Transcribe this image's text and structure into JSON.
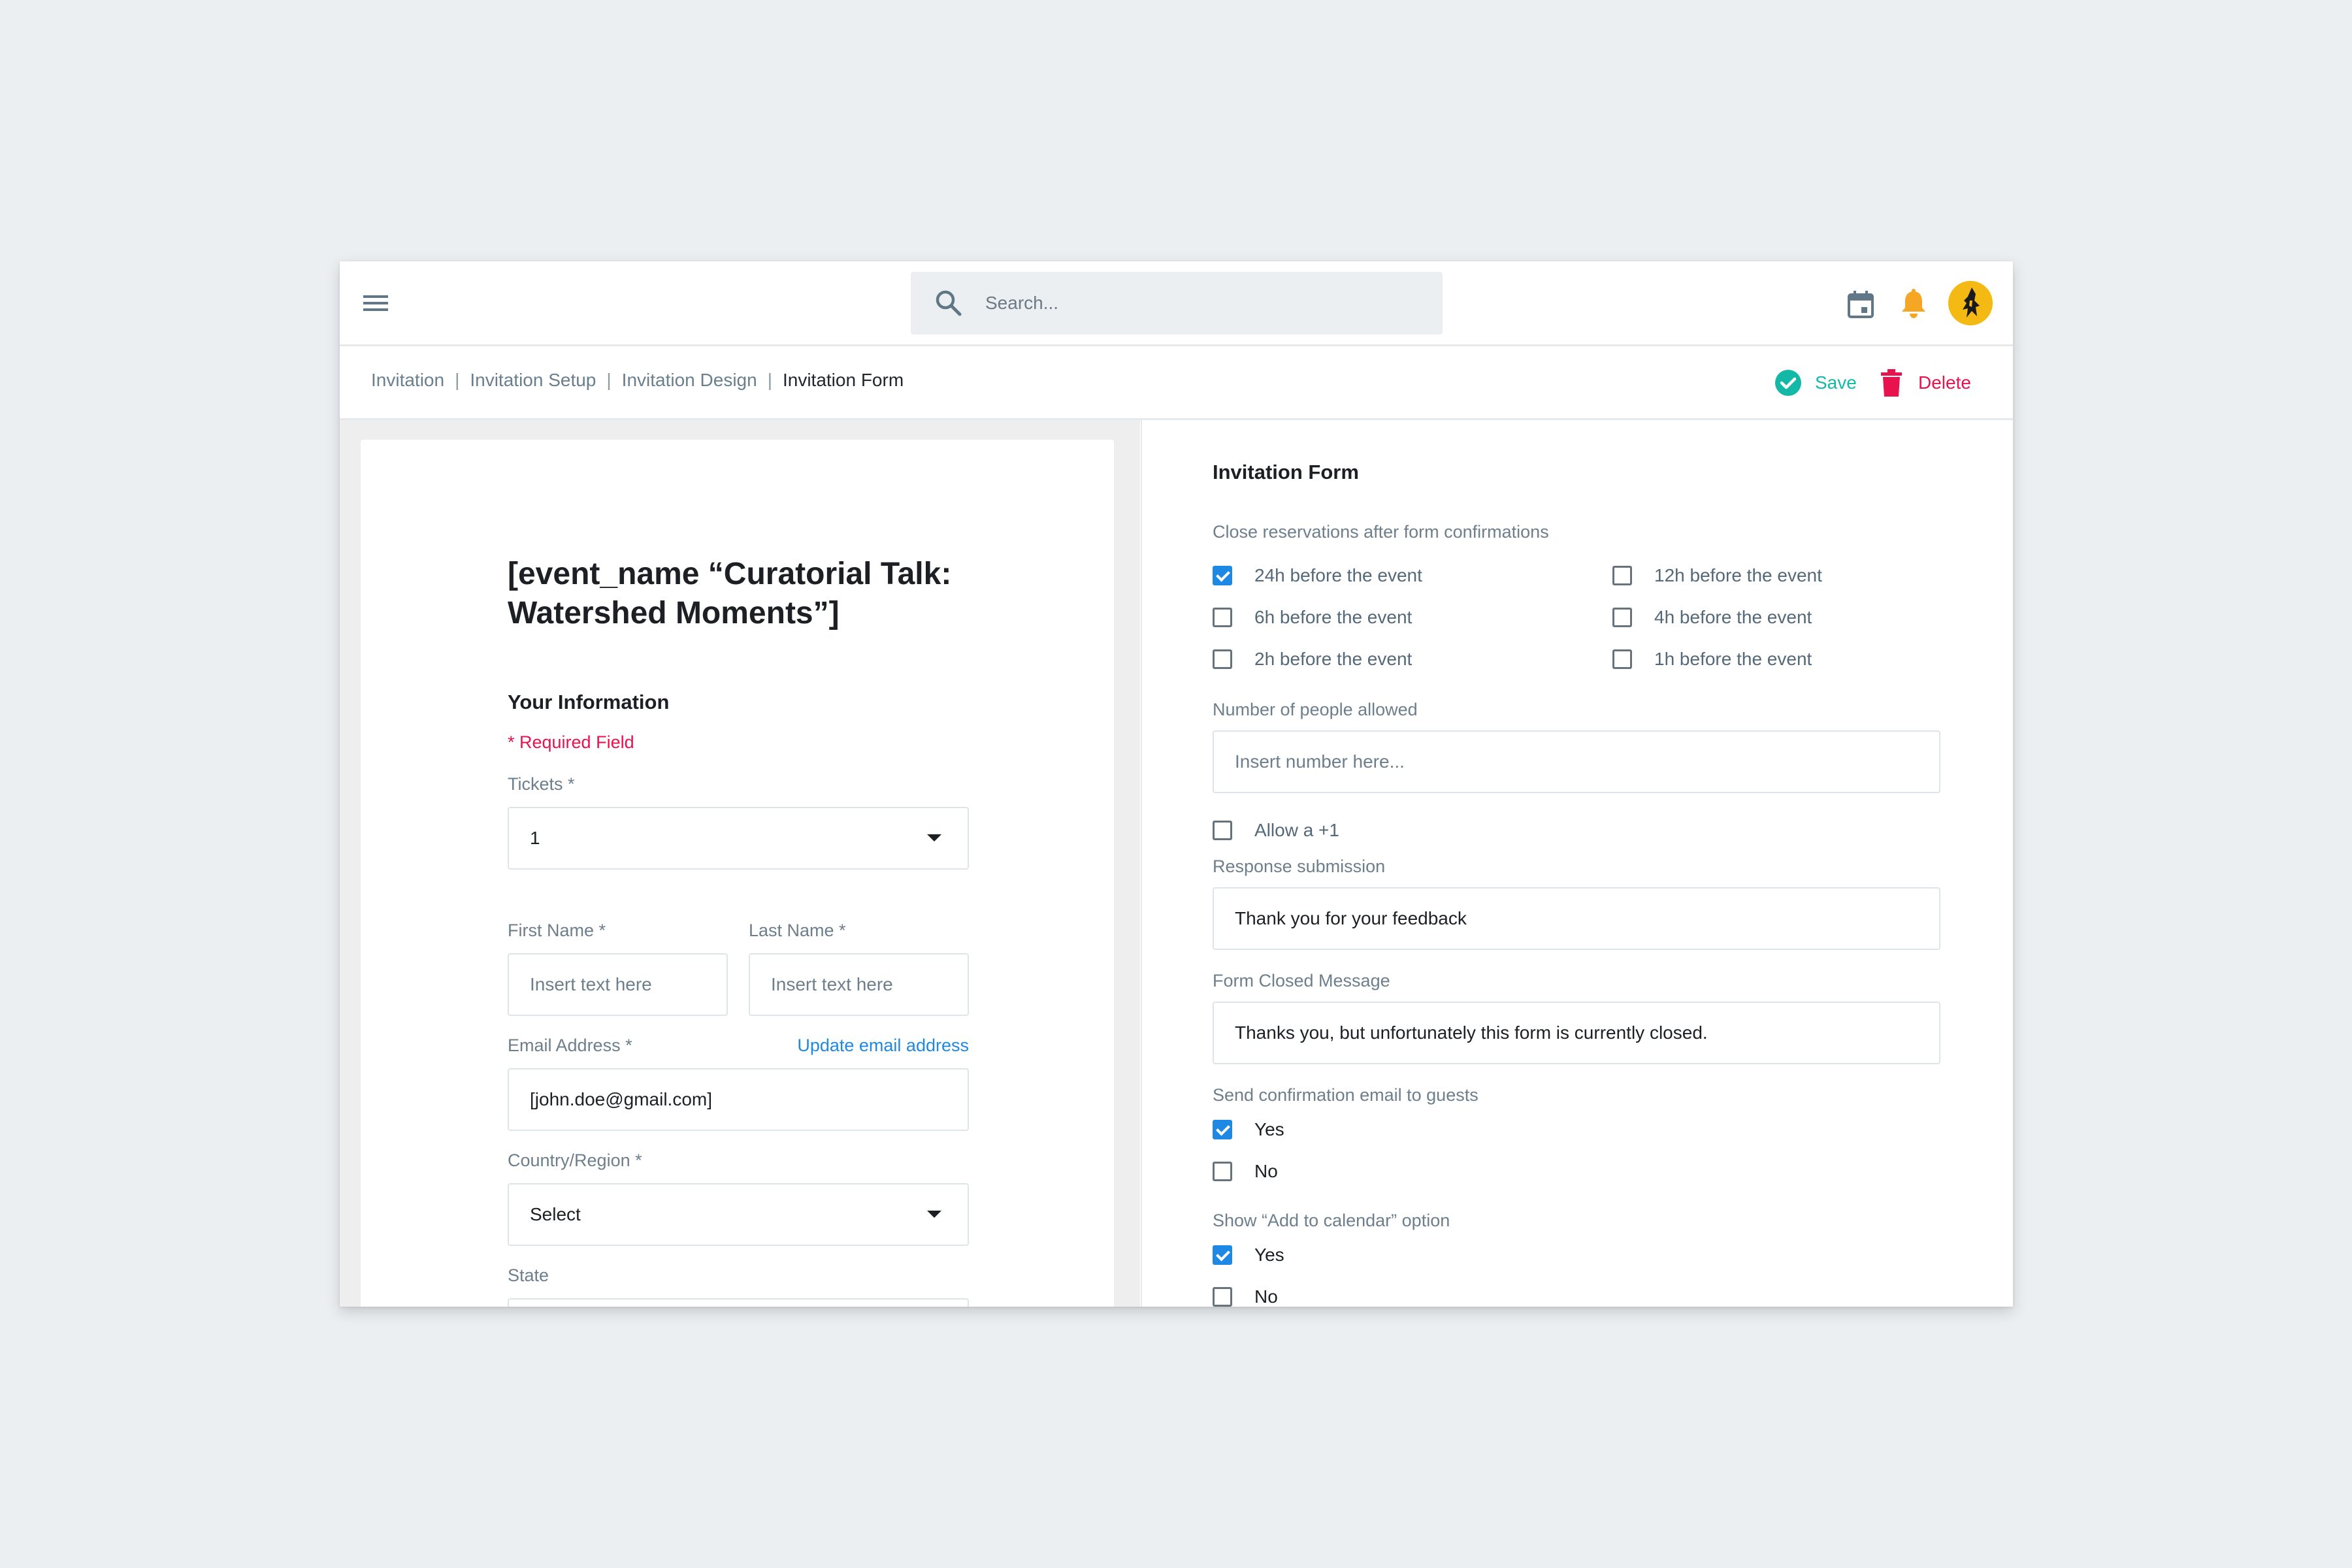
{
  "header": {
    "search_placeholder": "Search...",
    "icons": [
      "menu-icon",
      "search-icon",
      "calendar-icon",
      "bell-icon",
      "avatar"
    ],
    "accent_bell": "#f5a623"
  },
  "breadcrumb": {
    "items": [
      "Invitation",
      "Invitation Setup",
      "Invitation Design"
    ],
    "current": "Invitation Form",
    "separator": "|"
  },
  "actions": {
    "save_label": "Save",
    "save_color": "#14b8a6",
    "delete_label": "Delete",
    "delete_color": "#e8124f"
  },
  "form_preview": {
    "event_title": "[event_name “Curatorial Talk: Watershed Moments”]",
    "section_title": "Your Information",
    "required_note": "* Required Field",
    "tickets": {
      "label": "Tickets *",
      "value": "1"
    },
    "first_name": {
      "label": "First Name *",
      "placeholder": "Insert text here"
    },
    "last_name": {
      "label": "Last Name *",
      "placeholder": "Insert text here"
    },
    "email": {
      "label": "Email Address *",
      "value": "[john.doe@gmail.com]",
      "link": "Update email address"
    },
    "country": {
      "label": "Country/Region *",
      "value": "Select"
    },
    "state": {
      "label": "State"
    }
  },
  "settings": {
    "title": "Invitation Form",
    "close_reservations": {
      "label": "Close reservations after form confirmations",
      "options": [
        {
          "label": "24h before the event",
          "checked": true
        },
        {
          "label": "12h before the event",
          "checked": false
        },
        {
          "label": "6h before the event",
          "checked": false
        },
        {
          "label": "4h before the event",
          "checked": false
        },
        {
          "label": "2h before the event",
          "checked": false
        },
        {
          "label": "1h before the event",
          "checked": false
        }
      ]
    },
    "people_allowed": {
      "label": "Number of people allowed",
      "placeholder": "Insert number here..."
    },
    "allow_plus_one": {
      "label": "Allow a +1",
      "checked": false
    },
    "response_submission": {
      "label": "Response submission",
      "value": "Thank you for your feedback"
    },
    "form_closed": {
      "label": "Form Closed Message",
      "value": "Thanks you, but unfortunately this form is currently closed."
    },
    "confirmation_email": {
      "label": "Send confirmation email to guests",
      "yes": "Yes",
      "yes_checked": true,
      "no": "No",
      "no_checked": false
    },
    "add_to_calendar": {
      "label": "Show “Add to calendar” option",
      "yes": "Yes",
      "yes_checked": true,
      "no": "No",
      "no_checked": false
    }
  }
}
